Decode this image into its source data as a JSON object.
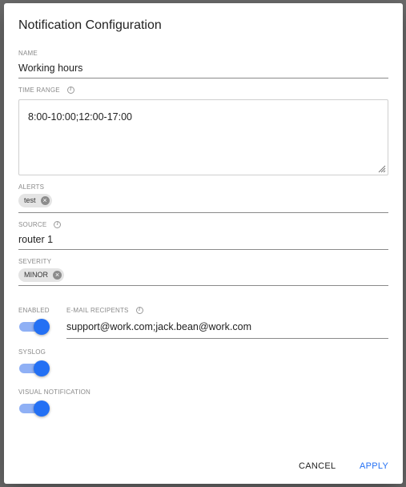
{
  "dialog": {
    "title": "Notification Configuration",
    "name": {
      "label": "NAME",
      "value": "Working hours"
    },
    "time_range": {
      "label": "TIME RANGE",
      "info_icon": "info-icon",
      "value": "8:00-10:00;12:00-17:00"
    },
    "alerts": {
      "label": "ALERTS",
      "chips": [
        "test"
      ]
    },
    "source": {
      "label": "SOURCE",
      "info_icon": "info-icon",
      "value": "router 1"
    },
    "severity": {
      "label": "SEVERITY",
      "chips": [
        "MINOR"
      ]
    },
    "enabled": {
      "label": "ENABLED",
      "on": true
    },
    "email": {
      "label": "E-MAIL RECIPENTS",
      "info_icon": "info-icon",
      "value": "support@work.com;jack.bean@work.com"
    },
    "syslog": {
      "label": "SYSLOG",
      "on": true
    },
    "visual_notification": {
      "label": "VISUAL NOTIFICATION",
      "on": true
    },
    "buttons": {
      "cancel": "CANCEL",
      "apply": "APPLY"
    }
  },
  "colors": {
    "accent": "#2370f4",
    "switch_track": "#8fb0f5",
    "chip_bg": "#e4e4e4",
    "label_gray": "#8a8a8a"
  }
}
